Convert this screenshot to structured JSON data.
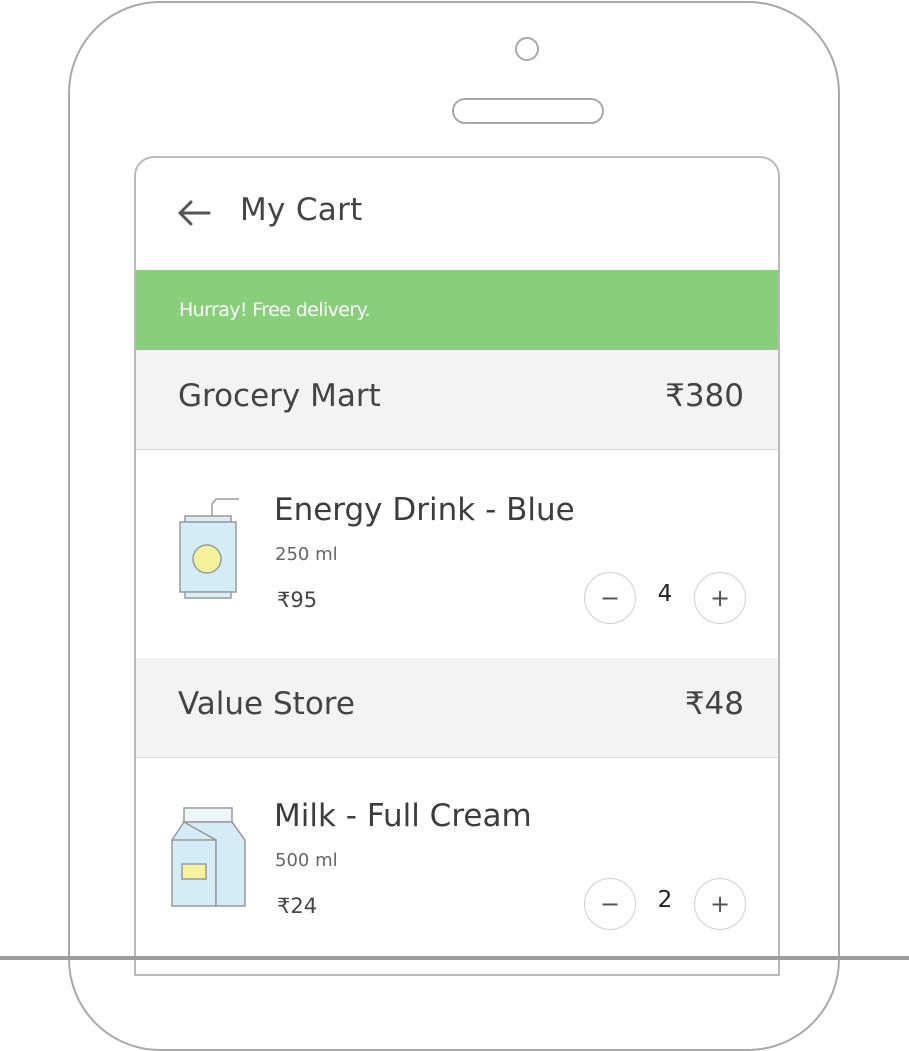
{
  "header": {
    "back_icon": "arrow-left-icon",
    "title": "My Cart"
  },
  "banner": {
    "text": "Hurray! Free delivery.",
    "color": "#88ce7b"
  },
  "stores": [
    {
      "name": "Grocery Mart",
      "total": "₹380",
      "items": [
        {
          "name": "Energy Drink - Blue",
          "size": "250 ml",
          "price": "₹95",
          "quantity": "4",
          "icon": "drink-can-icon"
        }
      ]
    },
    {
      "name": "Value Store",
      "total": "₹48",
      "items": [
        {
          "name": "Milk - Full Cream",
          "size": "500 ml",
          "price": "₹24",
          "quantity": "2",
          "icon": "milk-carton-icon"
        }
      ]
    }
  ],
  "controls": {
    "decrement": "−",
    "increment": "+"
  }
}
